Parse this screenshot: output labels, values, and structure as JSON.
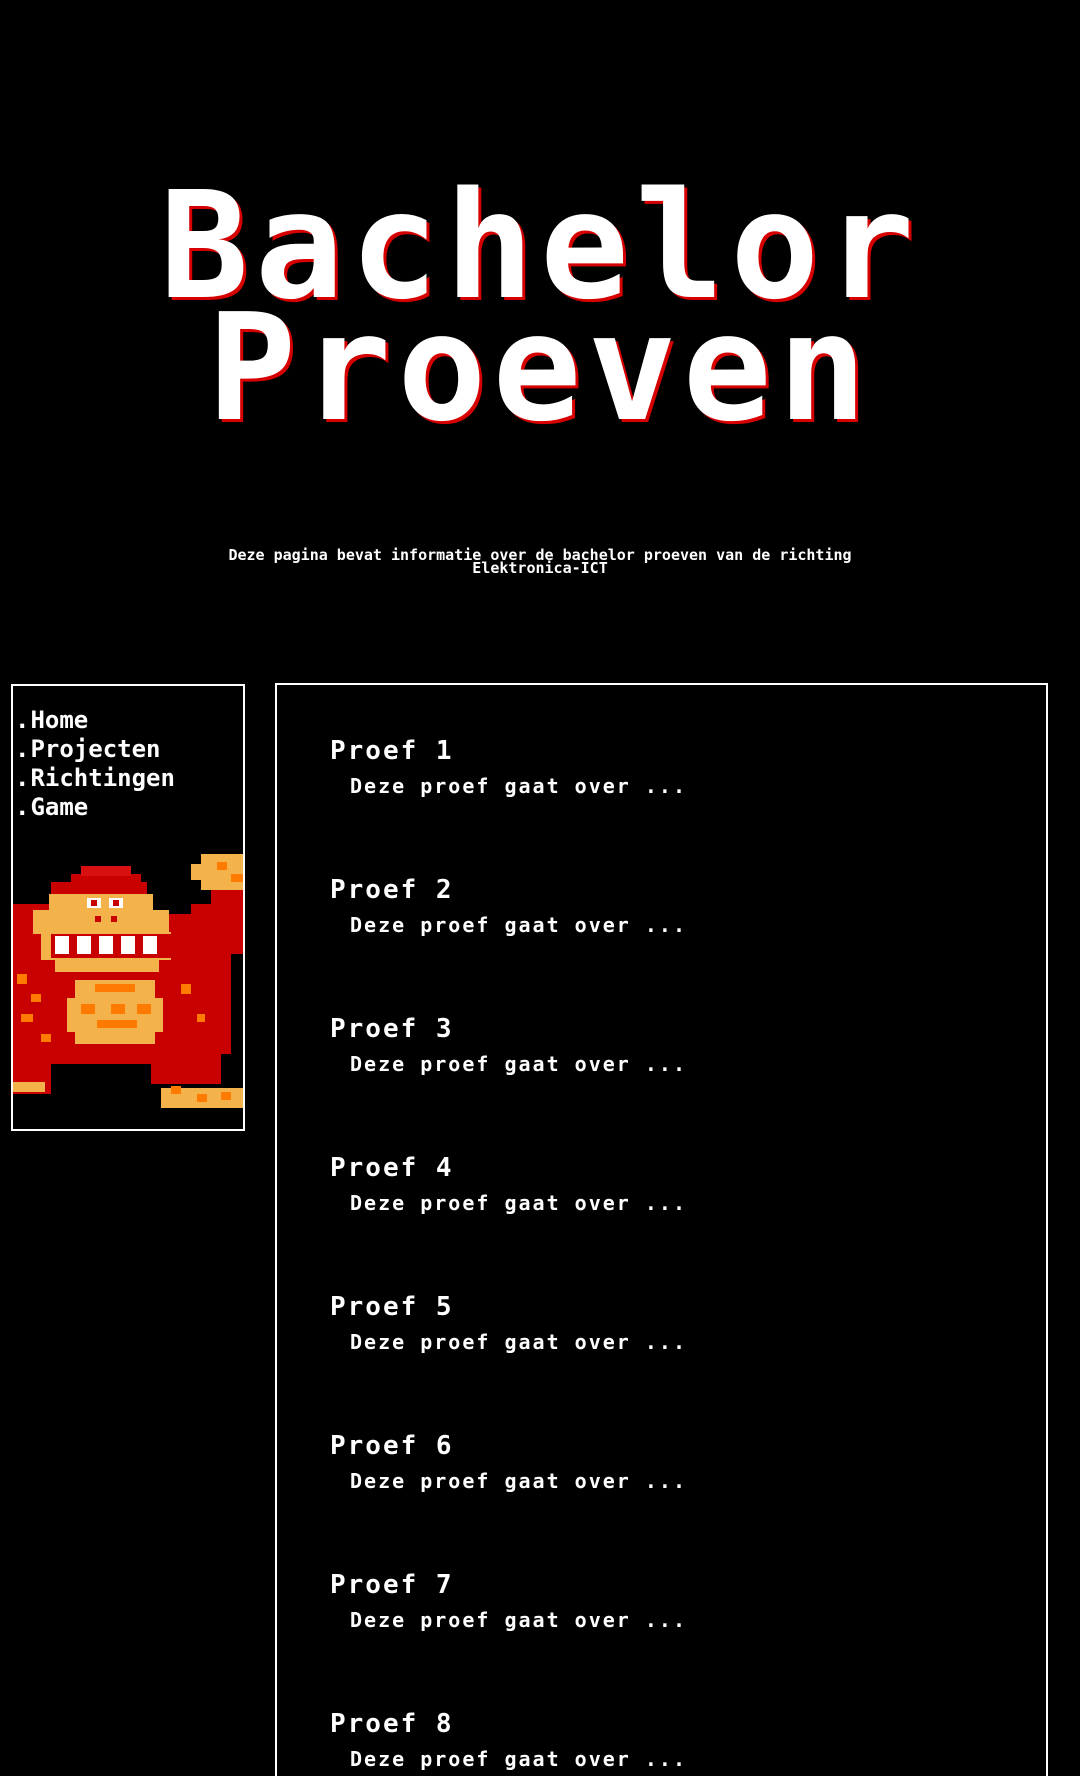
{
  "hero": {
    "title_line1": "Bachelor",
    "title_line2": "Proeven"
  },
  "subtitle": {
    "line1": "Deze pagina bevat informatie over de bachelor proeven van de richting",
    "line2": "Elektronica-ICT"
  },
  "nav": {
    "dot": ".",
    "items": [
      {
        "label": "Home"
      },
      {
        "label": "Projecten"
      },
      {
        "label": "Richtingen"
      },
      {
        "label": "Game"
      }
    ]
  },
  "sidebar": {
    "image_icon": "donkey-kong-sprite-icon"
  },
  "proofs": [
    {
      "title": "Proef 1",
      "description": "Deze proef gaat over ..."
    },
    {
      "title": "Proef 2",
      "description": "Deze proef gaat over ..."
    },
    {
      "title": "Proef 3",
      "description": "Deze proef gaat over ..."
    },
    {
      "title": "Proef 4",
      "description": "Deze proef gaat over ..."
    },
    {
      "title": "Proef 5",
      "description": "Deze proef gaat over ..."
    },
    {
      "title": "Proef 6",
      "description": "Deze proef gaat over ..."
    },
    {
      "title": "Proef 7",
      "description": "Deze proef gaat over ..."
    },
    {
      "title": "Proef 8",
      "description": "Deze proef gaat over ..."
    }
  ],
  "colors": {
    "background": "#000000",
    "text": "#ffffff",
    "title_shadow": "#d60000",
    "kong_dark": "#c80000",
    "kong_skin": "#f4b24a",
    "kong_orange": "#ff7a00"
  }
}
